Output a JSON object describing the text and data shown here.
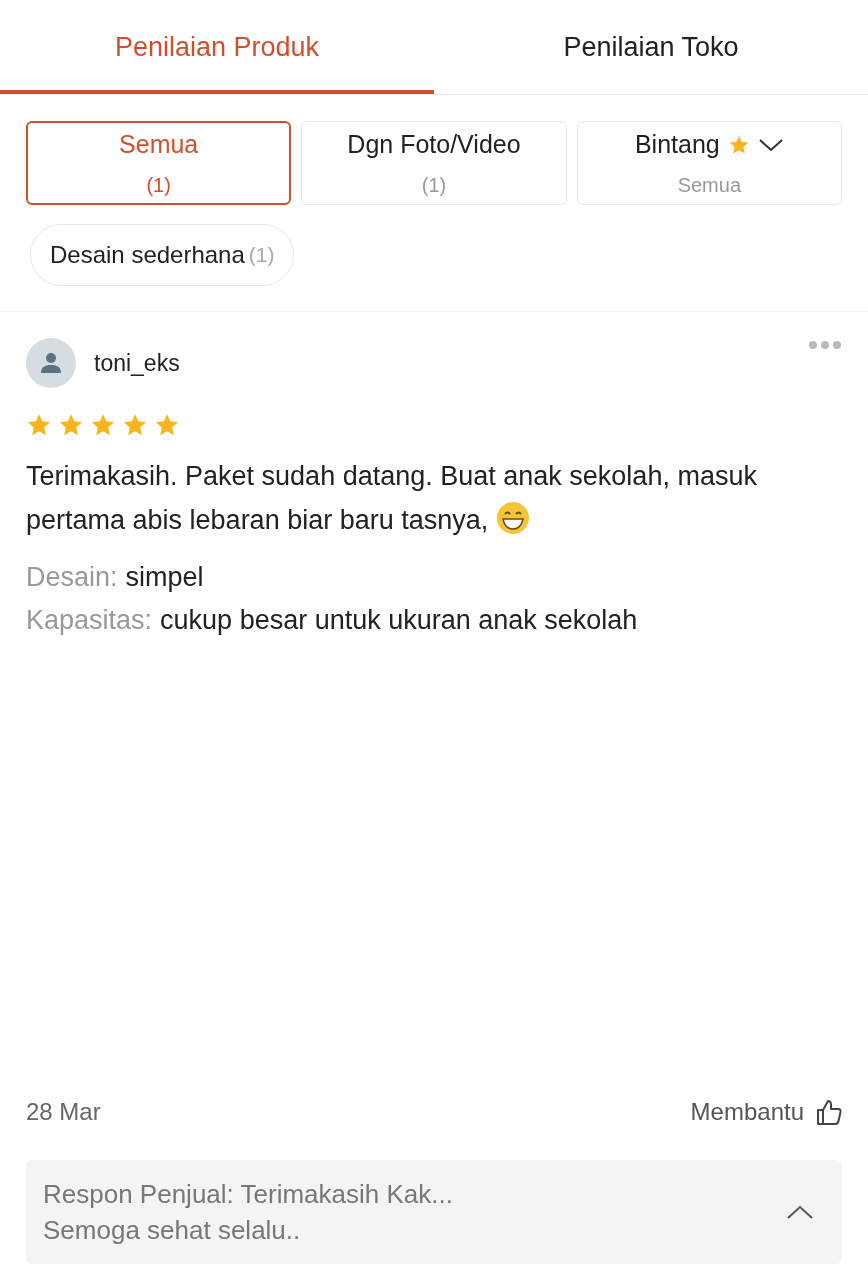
{
  "tabs": [
    {
      "label": "Penilaian Produk",
      "selected": true
    },
    {
      "label": "Penilaian Toko",
      "selected": false
    }
  ],
  "filters": [
    {
      "kind": "count",
      "label": "Semua",
      "sub": "(1)",
      "selected": true
    },
    {
      "kind": "count",
      "label": "Dgn Foto/Video",
      "sub": "(1)",
      "selected": false
    },
    {
      "kind": "stars",
      "label": "Bintang",
      "sub": "Semua",
      "selected": false
    }
  ],
  "chips": [
    {
      "label": "Desain sederhana",
      "count": "(1)",
      "selected": false
    }
  ],
  "review": {
    "user": "toni_eks",
    "stars": 5,
    "text": "Terimakasih. Paket sudah datang. Buat anak sekolah, masuk pertama abis lebaran biar baru tasnya,",
    "details": [
      {
        "label": "Desain:",
        "value": "simpel"
      },
      {
        "label": "Kapasitas:",
        "value": "cukup besar untuk ukuran anak sekolah"
      }
    ],
    "date": "28 Mar",
    "helpful": "Membantu",
    "seller_response": [
      "Respon Penjual: Terimakasih Kak...",
      "Semoga sehat selalu.."
    ]
  }
}
